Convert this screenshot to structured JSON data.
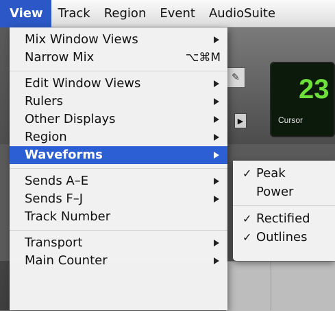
{
  "menubar": {
    "items": [
      "View",
      "Track",
      "Region",
      "Event",
      "AudioSuite"
    ],
    "active_index": 0
  },
  "app": {
    "counter_value": "23",
    "counter_label": "Cursor"
  },
  "view_menu": {
    "mix_window_views": "Mix Window Views",
    "narrow_mix": "Narrow Mix",
    "narrow_mix_shortcut": "⌥⌘M",
    "edit_window_views": "Edit Window Views",
    "rulers": "Rulers",
    "other_displays": "Other Displays",
    "region": "Region",
    "waveforms": "Waveforms",
    "sends_a_e": "Sends A–E",
    "sends_f_j": "Sends F–J",
    "track_number": "Track Number",
    "transport": "Transport",
    "main_counter": "Main Counter"
  },
  "waveforms_submenu": {
    "peak": "Peak",
    "power": "Power",
    "rectified": "Rectified",
    "outlines": "Outlines",
    "checked": [
      "Peak",
      "Rectified",
      "Outlines"
    ]
  },
  "icons": {
    "submenu_arrow": "triangle-right",
    "checkmark": "✓",
    "pencil": "✎",
    "play": "▶"
  },
  "colors": {
    "highlight": "#2d5fd4",
    "counter_text": "#6ee03a"
  }
}
